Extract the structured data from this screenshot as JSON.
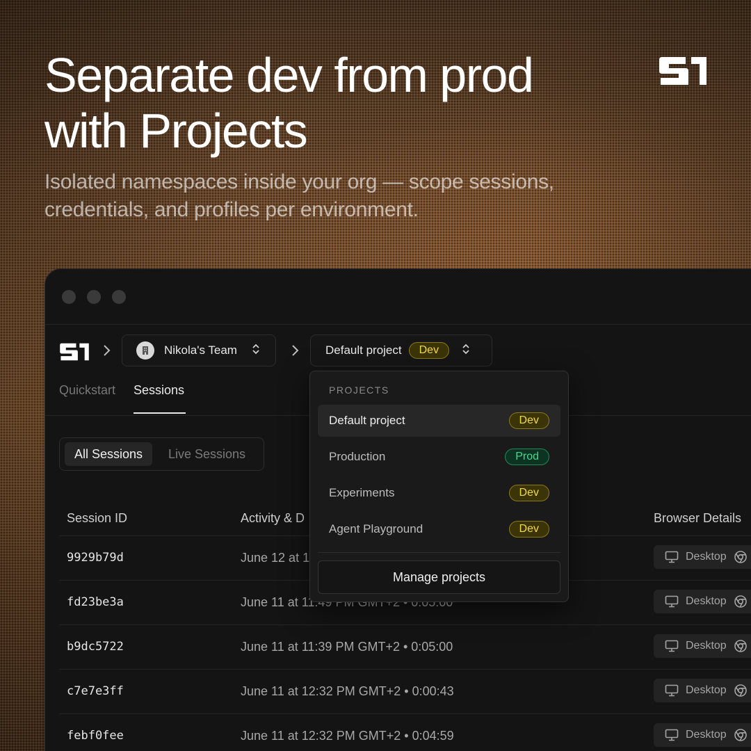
{
  "hero": {
    "title_line1": "Separate dev from prod",
    "title_line2": "with Projects",
    "subtitle_line1": "Isolated namespaces inside your org — scope sessions,",
    "subtitle_line2": "credentials, and profiles per environment."
  },
  "breadcrumb": {
    "team": "Nikola's Team",
    "project": "Default project",
    "project_badge": "Dev"
  },
  "tabs": [
    {
      "label": "Quickstart"
    },
    {
      "label": "Sessions"
    }
  ],
  "session_filter": {
    "options": [
      "All Sessions",
      "Live Sessions"
    ]
  },
  "table": {
    "headers": [
      "Session ID",
      "Activity & D",
      "Browser Details"
    ],
    "rows": [
      {
        "id": "9929b79d",
        "activity": "June 12 at 1",
        "browser": "Desktop"
      },
      {
        "id": "fd23be3a",
        "activity": "June 11 at 11:49 PM GMT+2 • 0:05:00",
        "browser": "Desktop"
      },
      {
        "id": "b9dc5722",
        "activity": "June 11 at 11:39 PM GMT+2 • 0:05:00",
        "browser": "Desktop"
      },
      {
        "id": "c7e7e3ff",
        "activity": "June 11 at 12:32 PM GMT+2 • 0:00:43",
        "browser": "Desktop"
      },
      {
        "id": "febf0fee",
        "activity": "June 11 at 12:32 PM GMT+2 • 0:04:59",
        "browser": "Desktop"
      }
    ]
  },
  "projects_dropdown": {
    "heading": "PROJECTS",
    "items": [
      {
        "name": "Default project",
        "badge": "Dev",
        "env": "dev",
        "selected": true
      },
      {
        "name": "Production",
        "badge": "Prod",
        "env": "prod",
        "selected": false
      },
      {
        "name": "Experiments",
        "badge": "Dev",
        "env": "dev",
        "selected": false
      },
      {
        "name": "Agent Playground",
        "badge": "Dev",
        "env": "dev",
        "selected": false
      }
    ],
    "manage_label": "Manage projects"
  },
  "colors": {
    "dev_badge_text": "#f2d94a",
    "prod_badge_text": "#3ddc8f",
    "window_bg": "#141414"
  },
  "icons": [
    "brand-logo-icon",
    "chevron-right-icon",
    "building-icon",
    "chevron-up-down-icon",
    "monitor-icon",
    "chrome-icon"
  ]
}
